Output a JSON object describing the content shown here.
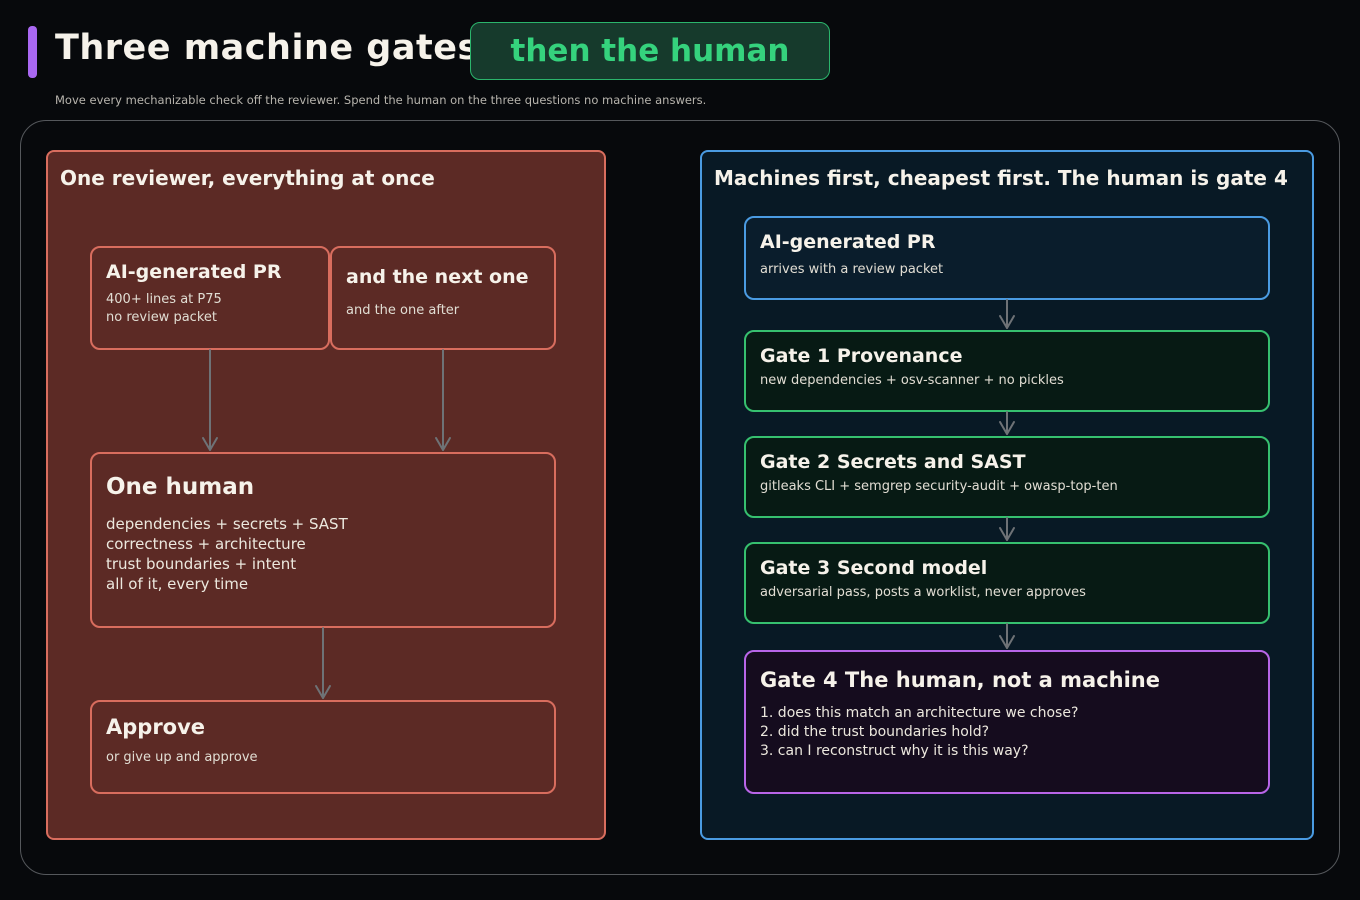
{
  "header": {
    "title": "Three machine gates",
    "pill": "then the human",
    "subtitle": "Move every mechanizable check off the reviewer. Spend the human on the three questions no machine answers."
  },
  "left": {
    "title": "One reviewer, everything at once",
    "pr": {
      "title": "AI-generated PR",
      "lines": [
        "400+ lines at P75",
        "no review packet"
      ]
    },
    "next": {
      "title": "and the next one",
      "sub": "and the one after"
    },
    "human": {
      "title": "One human",
      "lines": [
        "dependencies + secrets + SAST",
        "correctness + architecture",
        "trust boundaries + intent",
        "all of it, every time"
      ]
    },
    "approve": {
      "title": "Approve",
      "sub": "or give up and approve"
    }
  },
  "right": {
    "title": "Machines first, cheapest first. The human is gate 4",
    "pr": {
      "title": "AI-generated PR",
      "sub": "arrives with a review packet"
    },
    "gate1": {
      "title": "Gate 1 Provenance",
      "sub": "new dependencies + osv-scanner + no pickles"
    },
    "gate2": {
      "title": "Gate 2 Secrets and SAST",
      "sub": "gitleaks CLI + semgrep security-audit + owasp-top-ten"
    },
    "gate3": {
      "title": "Gate 3 Second model",
      "sub": "adversarial pass, posts a worklist, never approves"
    },
    "gate4": {
      "title": "Gate 4 The human, not a machine",
      "lines": [
        "1. does this match an architecture we chose?",
        "2. did the trust boundaries hold?",
        "3. can I reconstruct why it is this way?"
      ]
    }
  },
  "colors": {
    "background": "#07090c",
    "red_panel": "#5c2a25",
    "red_border": "#d86d5e",
    "blue_border": "#4a9be2",
    "green_border": "#36c06f",
    "purple_border": "#b865e8",
    "accent_purple": "#a968f2",
    "accent_green": "#35d27d",
    "arrow": "#6e7276"
  }
}
